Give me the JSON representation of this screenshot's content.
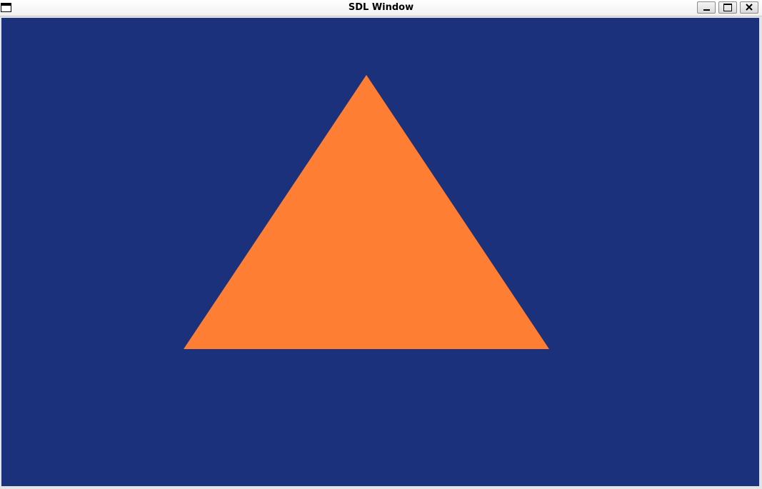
{
  "window": {
    "title": "SDL Window",
    "buttons": {
      "minimize": "minimize-icon",
      "maximize": "maximize-icon",
      "close": "close-icon"
    }
  },
  "scene": {
    "background_color": "#1b317c",
    "shape": "triangle",
    "shape_color": "#fe7f33"
  }
}
